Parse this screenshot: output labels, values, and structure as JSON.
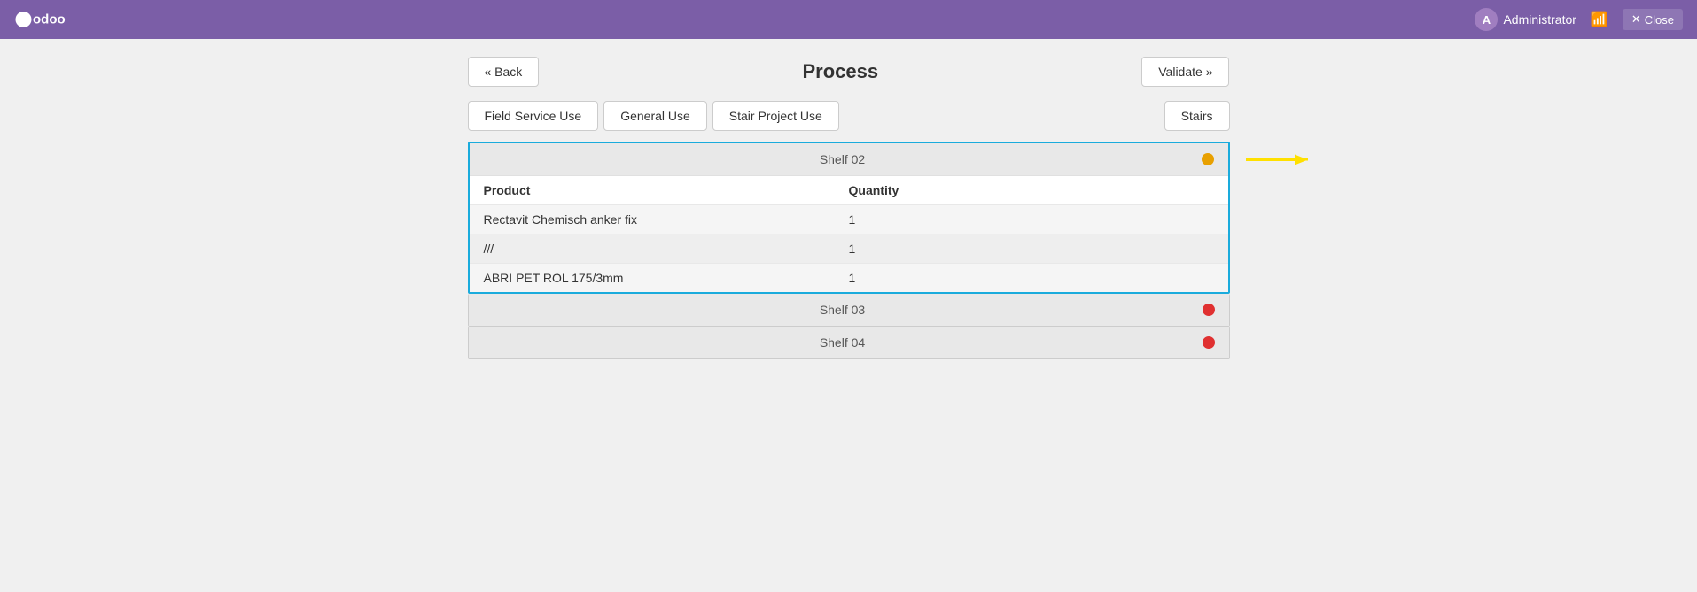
{
  "topbar": {
    "logo_text": "odoo",
    "user_initial": "A",
    "user_name": "Administrator",
    "wifi_icon": "wifi",
    "close_label": "Close"
  },
  "header": {
    "back_label": "« Back",
    "title": "Process",
    "validate_label": "Validate »"
  },
  "tabs": [
    {
      "id": "field-service",
      "label": "Field Service Use",
      "active": false
    },
    {
      "id": "general",
      "label": "General Use",
      "active": false
    },
    {
      "id": "stair-project",
      "label": "Stair Project Use",
      "active": false
    }
  ],
  "side_button": {
    "label": "Stairs"
  },
  "shelves": [
    {
      "id": "shelf-02",
      "title": "Shelf 02",
      "dot_color": "orange",
      "selected": true,
      "products": [
        {
          "name": "Rectavit Chemisch anker fix",
          "quantity": "1"
        },
        {
          "name": "///",
          "quantity": "1"
        },
        {
          "name": "ABRI PET ROL 175/3mm",
          "quantity": "1"
        }
      ]
    },
    {
      "id": "shelf-03",
      "title": "Shelf 03",
      "dot_color": "red",
      "selected": false,
      "products": []
    },
    {
      "id": "shelf-04",
      "title": "Shelf 04",
      "dot_color": "red",
      "selected": false,
      "products": []
    }
  ],
  "table_headers": {
    "product": "Product",
    "quantity": "Quantity"
  }
}
